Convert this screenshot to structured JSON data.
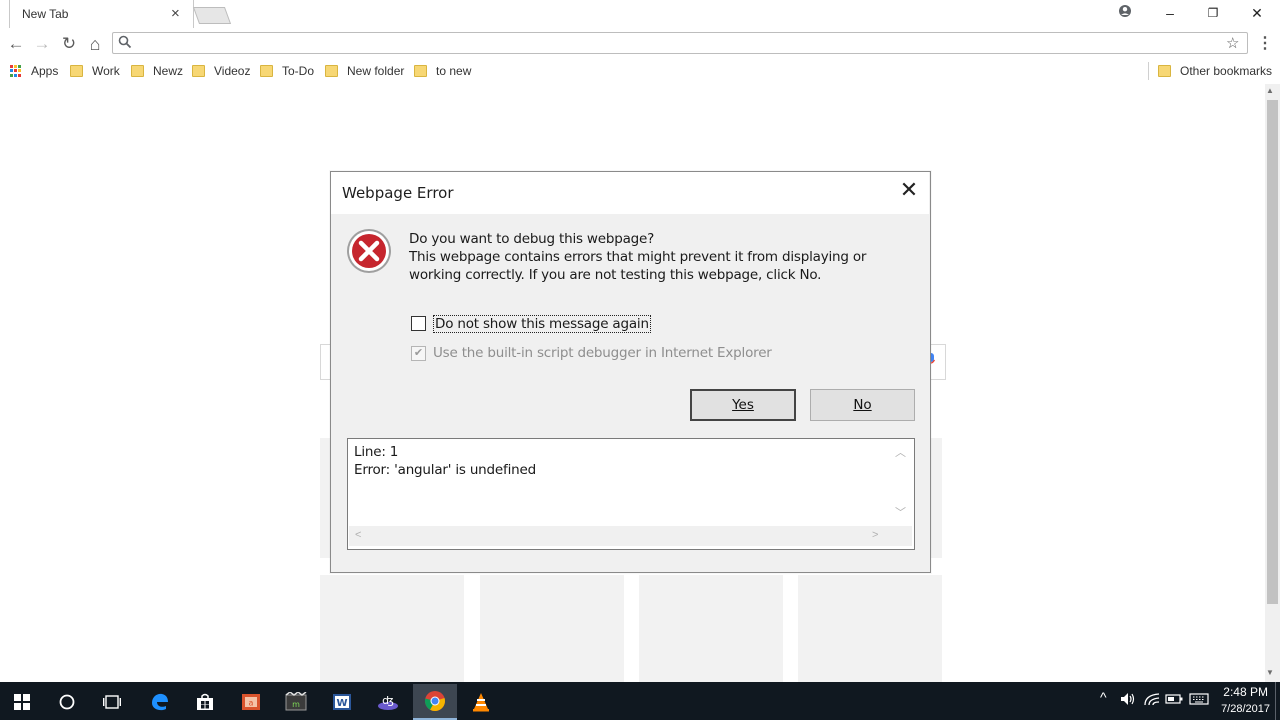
{
  "browser": {
    "tab_title": "New Tab",
    "tab_close": "×",
    "window_controls": {
      "account": "account-icon",
      "minimize": "–",
      "restore": "❐",
      "close": "✕"
    },
    "nav": {
      "back": "←",
      "forward": "→",
      "reload": "↻",
      "home": "⌂"
    },
    "omnibox": {
      "value": "",
      "placeholder": ""
    },
    "star": "☆",
    "menu": "⋮",
    "bookmarks": [
      {
        "label": "Apps",
        "icon": "apps-grid-icon"
      },
      {
        "label": "Work",
        "icon": "folder-icon"
      },
      {
        "label": "Newz",
        "icon": "folder-icon"
      },
      {
        "label": "Videoz",
        "icon": "folder-icon"
      },
      {
        "label": "To-Do",
        "icon": "folder-icon"
      },
      {
        "label": "New folder",
        "icon": "folder-icon"
      },
      {
        "label": "to new",
        "icon": "folder-icon"
      }
    ],
    "other_bookmarks": "Other bookmarks"
  },
  "dialog": {
    "title": "Webpage Error",
    "close": "✕",
    "icon": "error-icon",
    "question": "Do you want to debug this webpage?",
    "message_line1": "This webpage contains errors that might prevent it from displaying or",
    "message_line2": "working correctly. If you are not testing this webpage, click No.",
    "checkbox_dont_show": {
      "label": "Do not show this message again",
      "checked": false
    },
    "checkbox_builtin_debugger": {
      "label": "Use the built-in script debugger in Internet Explorer",
      "checked": true,
      "enabled": false
    },
    "yes_label": "Yes",
    "no_label": "No",
    "details": {
      "line1": "Line: 1",
      "line2": "Error: 'angular' is undefined"
    }
  },
  "taskbar": {
    "apps": [
      "windows-start-icon",
      "cortana-icon",
      "task-view-icon",
      "edge-icon",
      "store-icon",
      "powerpoint-icon",
      "video-editor-icon",
      "word-icon",
      "visual-studio-icon",
      "chrome-icon",
      "vlc-icon"
    ],
    "tray_chevron": "^",
    "clock_time": "2:48 PM",
    "clock_date": "7/28/2017"
  },
  "colors": {
    "taskbar_bg": "#101820",
    "dialog_bg": "#f0f0f0",
    "error_red": "#c6262e",
    "folder_yellow": "#f7d774",
    "chrome_active_indicator": "#8fb4d9"
  }
}
